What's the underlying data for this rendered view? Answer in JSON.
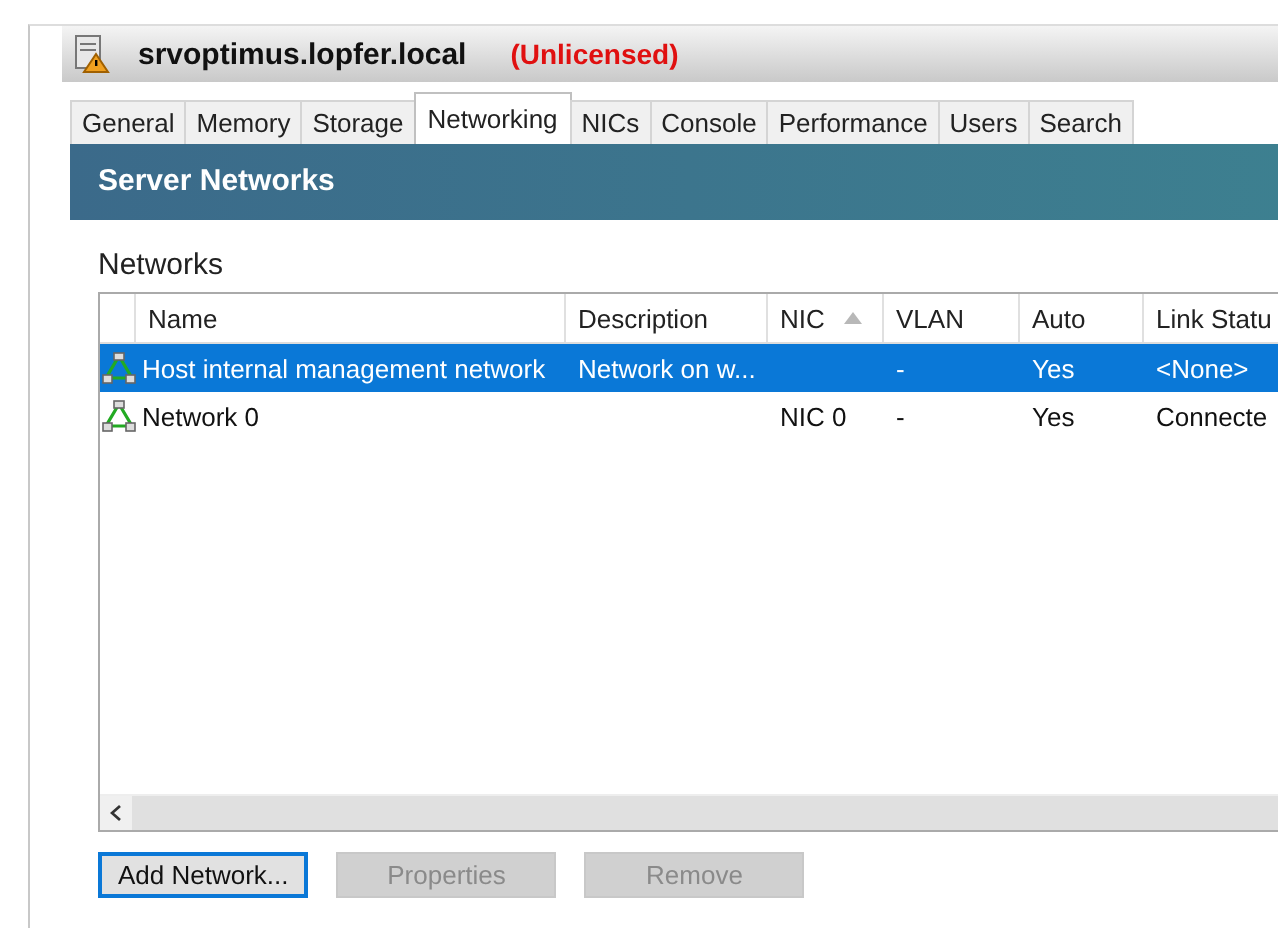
{
  "window": {
    "title": "srvoptimus.lopfer.local",
    "license_status": "(Unlicensed)"
  },
  "tabs": [
    {
      "label": "General",
      "selected": false
    },
    {
      "label": "Memory",
      "selected": false
    },
    {
      "label": "Storage",
      "selected": false
    },
    {
      "label": "Networking",
      "selected": true
    },
    {
      "label": "NICs",
      "selected": false
    },
    {
      "label": "Console",
      "selected": false
    },
    {
      "label": "Performance",
      "selected": false
    },
    {
      "label": "Users",
      "selected": false
    },
    {
      "label": "Search",
      "selected": false
    }
  ],
  "header": "Server Networks",
  "section_label": "Networks",
  "table": {
    "columns": [
      {
        "label": "Name",
        "sorted": false
      },
      {
        "label": "Description",
        "sorted": false
      },
      {
        "label": "NIC",
        "sorted": true
      },
      {
        "label": "VLAN",
        "sorted": false
      },
      {
        "label": "Auto",
        "sorted": false
      },
      {
        "label": "Link Statu",
        "sorted": false
      }
    ],
    "rows": [
      {
        "cells": [
          "Host internal management network",
          "Network on w...",
          "",
          "-",
          "Yes",
          "<None>"
        ],
        "selected": true
      },
      {
        "cells": [
          "Network 0",
          "",
          "NIC 0",
          "-",
          "Yes",
          "Connecte"
        ],
        "selected": false
      }
    ]
  },
  "buttons": [
    {
      "label": "Add Network...",
      "disabled": false,
      "focused": true
    },
    {
      "label": "Properties",
      "disabled": true,
      "focused": false
    },
    {
      "label": "Remove",
      "disabled": true,
      "focused": false
    }
  ]
}
